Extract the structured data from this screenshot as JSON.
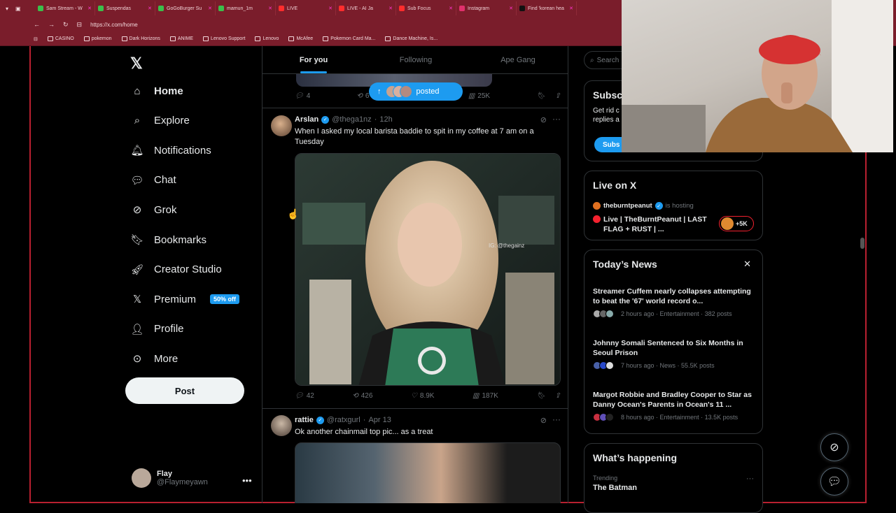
{
  "browser": {
    "tabs": [
      {
        "label": "Sam Stream - W",
        "color": "#3bbf4b"
      },
      {
        "label": "Suspendas",
        "color": "#3bbf4b"
      },
      {
        "label": "GoGoBurger Su",
        "color": "#3bbf4b"
      },
      {
        "label": "mamun_1m",
        "color": "#3bbf4b"
      },
      {
        "label": "LIVE",
        "color": "#ff2d2d"
      },
      {
        "label": "LIVE - AI Ja",
        "color": "#ff2d2d"
      },
      {
        "label": "Sub Focus",
        "color": "#ff2d2d"
      },
      {
        "label": "Instagram",
        "color": "#e1306c"
      },
      {
        "label": "Find 'korean hea",
        "color": "#111111"
      }
    ],
    "url": "https://x.com/home",
    "bookmarks": [
      "CASINO",
      "pokemon",
      "Dark Horizons",
      "ANIME",
      "Lenovo Support",
      "Lenovo",
      "McAfee",
      "Pokemon Card Ma...",
      "Dance Machine, Is..."
    ]
  },
  "nav": {
    "items": [
      {
        "label": "Home",
        "icon": "home-icon"
      },
      {
        "label": "Explore",
        "icon": "search-icon"
      },
      {
        "label": "Notifications",
        "icon": "bell-icon"
      },
      {
        "label": "Chat",
        "icon": "chat-icon"
      },
      {
        "label": "Grok",
        "icon": "grok-icon"
      },
      {
        "label": "Bookmarks",
        "icon": "bookmark-icon"
      },
      {
        "label": "Creator Studio",
        "icon": "rocket-icon"
      },
      {
        "label": "Premium",
        "icon": "x-logo-icon"
      },
      {
        "label": "Profile",
        "icon": "person-icon"
      },
      {
        "label": "More",
        "icon": "more-circle-icon"
      }
    ],
    "premium_badge": "50% off",
    "post_label": "Post",
    "account": {
      "name": "Flay",
      "handle": "@Flaymeyawn"
    }
  },
  "feed": {
    "tabs": [
      "For you",
      "Following",
      "Ape Gang"
    ],
    "prev_tweet": {
      "replies": "4",
      "reposts": "6",
      "likes": "",
      "views": "25K"
    },
    "new_posts_label": "posted",
    "tweets": [
      {
        "name": "Arslan",
        "handle": "@thega1nz",
        "time": "12h",
        "text": "When I asked my local barista baddie to spit in my coffee at 7 am on a Tuesday",
        "watermark": "IG: @thegainz",
        "replies": "42",
        "reposts": "426",
        "likes": "8.9K",
        "views": "187K"
      },
      {
        "name": "rattie",
        "handle": "@ratxgurl",
        "time": "Apr 13",
        "text": "Ok another chainmail top pic... as a treat"
      }
    ]
  },
  "right": {
    "search_placeholder": "Search",
    "subscribe": {
      "title": "Subsc",
      "text": "Get rid c replies a",
      "button": "Subs"
    },
    "live": {
      "title": "Live on X",
      "host": "theburntpeanut",
      "hosting_label": "is hosting",
      "stream_title": "Live | TheBurntPeanut | LAST FLAG + RUST | ...",
      "listeners": "+5K"
    },
    "news": {
      "title": "Today’s News",
      "items": [
        {
          "headline": "Streamer Cuffem nearly collapses attempting to beat the '67' world record o...",
          "meta": "2 hours ago · Entertainment · 382 posts"
        },
        {
          "headline": "Johnny Somali Sentenced to Six Months in Seoul Prison",
          "meta": "7 hours ago · News · 55.5K posts"
        },
        {
          "headline": "Margot Robbie and Bradley Cooper to Star as Danny Ocean's Parents in Ocean's 11 ...",
          "meta": "8 hours ago · Entertainment · 13.5K posts"
        }
      ]
    },
    "happening": {
      "title": "What’s happening",
      "category": "Trending",
      "topic": "The Batman"
    }
  },
  "colors": {
    "accent": "#1d9bf0",
    "browser_chrome": "#7a1d2b",
    "live_red": "#f4212e"
  }
}
